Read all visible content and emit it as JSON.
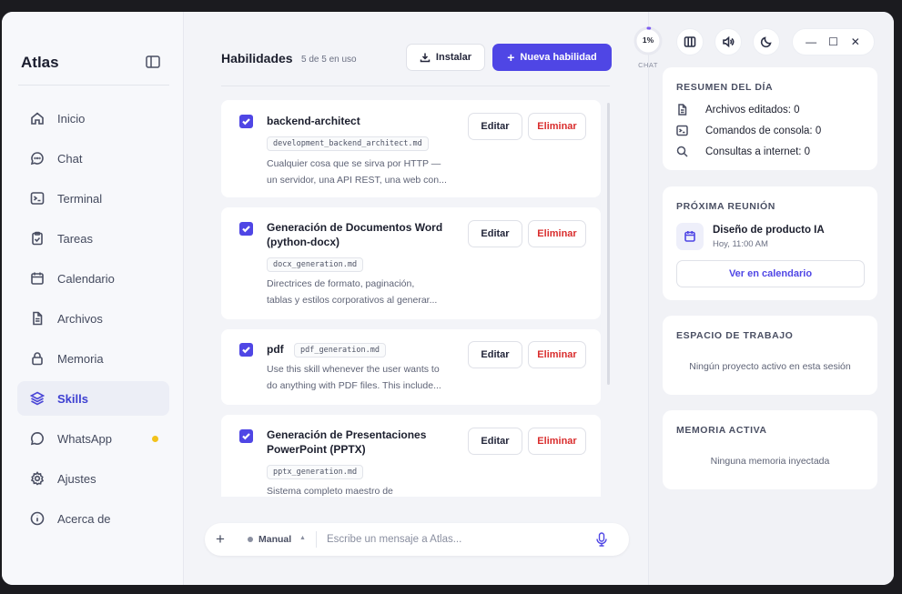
{
  "app": {
    "name": "Atlas"
  },
  "sidebar": {
    "items": [
      {
        "label": "Inicio",
        "icon": "home-icon"
      },
      {
        "label": "Chat",
        "icon": "chat-icon"
      },
      {
        "label": "Terminal",
        "icon": "terminal-icon"
      },
      {
        "label": "Tareas",
        "icon": "clipboard-icon"
      },
      {
        "label": "Calendario",
        "icon": "calendar-icon"
      },
      {
        "label": "Archivos",
        "icon": "file-icon"
      },
      {
        "label": "Memoria",
        "icon": "lock-icon"
      },
      {
        "label": "Skills",
        "icon": "layers-icon",
        "active": true
      },
      {
        "label": "WhatsApp",
        "icon": "whatsapp-icon",
        "badge": "notification-dot"
      },
      {
        "label": "Ajustes",
        "icon": "gear-icon"
      },
      {
        "label": "Acerca de",
        "icon": "info-icon"
      }
    ]
  },
  "main": {
    "title": "Habilidades",
    "count": "5 de 5 en uso",
    "install_label": "Instalar",
    "new_label": "Nueva habilidad",
    "edit_label": "Editar",
    "delete_label": "Eliminar",
    "skills": [
      {
        "name": "backend-architect",
        "file": "development_backend_architect.md",
        "desc": [
          "Cualquier cosa que se sirva por HTTP —",
          "un servidor, una API REST, una web con..."
        ],
        "enabled": true
      },
      {
        "name_lines": [
          "Generación de Documentos Word",
          "(python-docx)"
        ],
        "file": "docx_generation.md",
        "desc": [
          "Directrices de formato, paginación,",
          "tablas y estilos corporativos al generar..."
        ],
        "enabled": true
      },
      {
        "name": "pdf",
        "file": "pdf_generation.md",
        "desc": [
          "Use this skill whenever the user wants to",
          "do anything with PDF files. This include..."
        ],
        "enabled": true
      },
      {
        "name_lines": [
          "Generación de Presentaciones",
          "PowerPoint (PPTX)"
        ],
        "file": "pptx_generation.md",
        "desc": [
          "Sistema completo maestro de"
        ],
        "enabled": true
      }
    ]
  },
  "composer": {
    "mode": "Manual",
    "placeholder": "Escribe un mensaje a Atlas..."
  },
  "topbar": {
    "usage": "1%",
    "usage_value": 0.01,
    "usage_label": "CHAT"
  },
  "summary": {
    "title": "RESUMEN DEL DÍA",
    "files": "Archivos editados: 0",
    "commands": "Comandos de consola: 0",
    "queries": "Consultas a internet: 0"
  },
  "meeting": {
    "title": "PRÓXIMA REUNIÓN",
    "name": "Diseño de producto IA",
    "time": "Hoy, 11:00 AM",
    "button": "Ver en calendario"
  },
  "workspace": {
    "title": "ESPACIO DE TRABAJO",
    "empty": "Ningún proyecto activo en esta sesión"
  },
  "memory": {
    "title": "MEMORIA ACTIVA",
    "empty": "Ninguna memoria inyectada"
  },
  "colors": {
    "accent": "#4f46e5",
    "danger": "#d92d2d",
    "badge": "#f2c21b"
  }
}
